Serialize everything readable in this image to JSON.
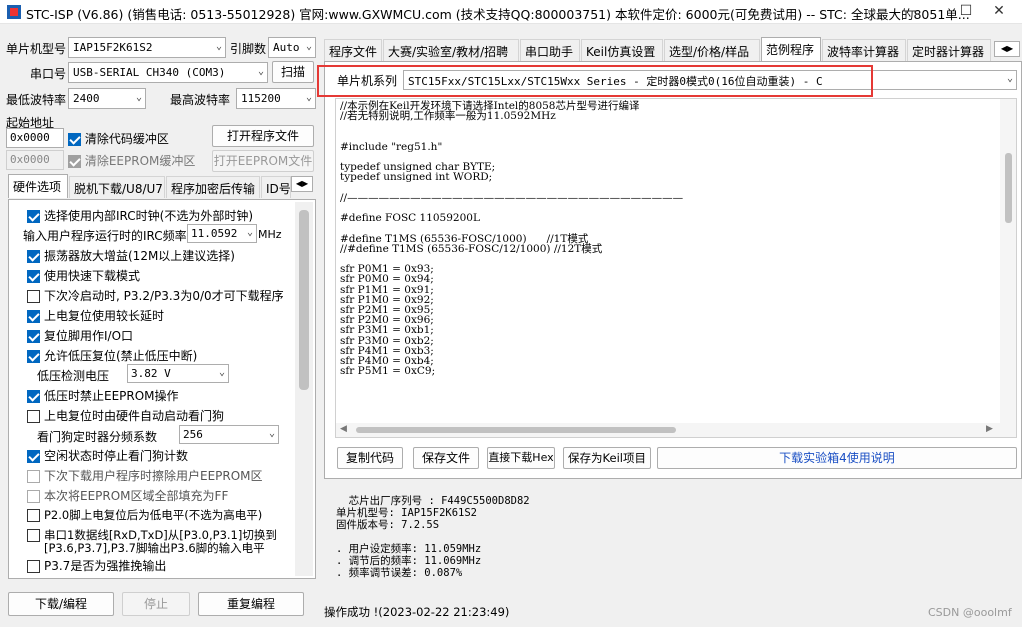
{
  "window": {
    "title": "STC-ISP (V6.86) (销售电话: 0513-55012928) 官网:www.GXWMCU.com  (技术支持QQ:800003751) 本软件定价: 6000元(可免费试用) -- STC: 全球最大的8051单..."
  },
  "left": {
    "mcu_label": "单片机型号",
    "mcu_value": "IAP15F2K61S2",
    "pins_label": "引脚数",
    "pins_value": "Auto",
    "port_label": "串口号",
    "port_value": "USB-SERIAL CH340 (COM3)",
    "scan_button": "扫描",
    "min_baud_label": "最低波特率",
    "min_baud_value": "2400",
    "max_baud_label": "最高波特率",
    "max_baud_value": "115200",
    "start_addr_label": "起始地址",
    "addr1_value": "0x0000",
    "clear_code_label": "清除代码缓冲区",
    "open_prog_button": "打开程序文件",
    "addr2_value": "0x0000",
    "clear_eeprom_label": "清除EEPROM缓冲区",
    "open_eeprom_button": "打开EEPROM文件",
    "tabs": [
      "硬件选项",
      "脱机下载/U8/U7",
      "程序加密后传输",
      "ID号"
    ],
    "options": [
      {
        "label": "选择使用内部IRC时钟(不选为外部时钟)",
        "checked": true
      },
      {
        "label": "振荡器放大增益(12M以上建议选择)",
        "checked": true
      },
      {
        "label": "使用快速下载模式",
        "checked": true
      },
      {
        "label": "下次冷启动时, P3.2/P3.3为0/0才可下载程序",
        "checked": false
      },
      {
        "label": "上电复位使用较长延时",
        "checked": true
      },
      {
        "label": "复位脚用作I/O口",
        "checked": true
      },
      {
        "label": "允许低压复位(禁止低压中断)",
        "checked": true
      },
      {
        "label": "低压时禁止EEPROM操作",
        "checked": true
      },
      {
        "label": "上电复位时由硬件自动启动看门狗",
        "checked": false
      },
      {
        "label": "空闲状态时停止看门狗计数",
        "checked": true
      },
      {
        "label": "下次下载用户程序时擦除用户EEPROM区",
        "checked": false
      },
      {
        "label": "本次将EEPROM区域全部填充为FF",
        "checked": false
      },
      {
        "label": "P2.0脚上电复位后为低电平(不选为高电平)",
        "checked": false
      },
      {
        "label": "串口1数据线[RxD,TxD]从[P3.0,P3.1]切换到",
        "checked": false
      },
      {
        "label": "[P3.6,P3.7],P3.7脚输出P3.6脚的输入电平",
        "checked": null
      },
      {
        "label": "P3.7是否为强推挽输出",
        "checked": false
      }
    ],
    "irc_label": "输入用户程序运行时的IRC频率",
    "irc_value": "11.0592",
    "irc_unit": "MHz",
    "lvd_label": "低压检测电压",
    "lvd_value": "3.82 V",
    "wdt_label": "看门狗定时器分频系数",
    "wdt_value": "256",
    "download_button": "下载/编程",
    "stop_button": "停止",
    "reprogram_button": "重复编程"
  },
  "right": {
    "tabs": [
      "程序文件",
      "大赛/实验室/教材/招聘",
      "串口助手",
      "Keil仿真设置",
      "选型/价格/样品",
      "范例程序",
      "波特率计算器",
      "定时器计算器"
    ],
    "active_tab": "范例程序",
    "series_label": "单片机系列",
    "series_value": "STC15Fxx/STC15Lxx/STC15Wxx Series - 定时器0模式0(16位自动重装) - C",
    "code_text": "//本示例在Keil开发环境下请选择Intel的8058芯片型号进行编译\n//若无特别说明,工作频率一般为11.0592MHz\n\n\n#include \"reg51.h\"\n\ntypedef unsigned char BYTE;\ntypedef unsigned int WORD;\n\n//————————————————————————————————\n\n#define FOSC 11059200L\n\n#define T1MS (65536-FOSC/1000)      //1T模式\n//#define T1MS (65536-FOSC/12/1000) //12T模式\n\nsfr P0M1 = 0x93;\nsfr P0M0 = 0x94;\nsfr P1M1 = 0x91;\nsfr P1M0 = 0x92;\nsfr P2M1 = 0x95;\nsfr P2M0 = 0x96;\nsfr P3M1 = 0xb1;\nsfr P3M0 = 0xb2;\nsfr P4M1 = 0xb3;\nsfr P4M0 = 0xb4;\nsfr P5M1 = 0xC9;",
    "copy_button": "复制代码",
    "save_button": "保存文件",
    "direct_download_button": "直接下载Hex",
    "save_keil_button": "保存为Keil项目",
    "lab_link": "下载实验箱4使用说明",
    "info_lines": [
      "  芯片出厂序列号 : F449C5500D8D82",
      "单片机型号: IAP15F2K61S2",
      "固件版本号: 7.2.5S",
      "",
      ". 用户设定频率: 11.059MHz",
      ". 调节后的频率: 11.069MHz",
      ". 频率调节误差: 0.087%"
    ],
    "status": "操作成功 !(2023-02-22 21:23:49)"
  },
  "watermark": "CSDN @ooolmf"
}
